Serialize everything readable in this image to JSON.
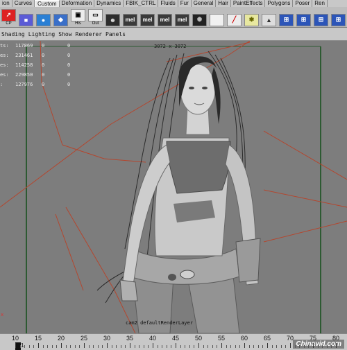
{
  "shelf_tabs": [
    "ion",
    "Curves",
    "Custom",
    "Deformation",
    "Dynamics",
    "FBIK_CTRL",
    "Fluids",
    "Fur",
    "General",
    "Hair",
    "PaintEffects",
    "Polygons",
    "Poser",
    "Ren"
  ],
  "active_tab": "Custom",
  "shelf_icons": [
    {
      "name": "cp-icon",
      "label": "CP"
    },
    {
      "name": "cube-icon",
      "label": ""
    },
    {
      "name": "sphere-icon",
      "label": ""
    },
    {
      "name": "plane-icon",
      "label": ""
    },
    {
      "name": "his-icon",
      "label": "His"
    },
    {
      "name": "out-icon",
      "label": "Out"
    },
    {
      "name": "head-icon",
      "label": ""
    },
    {
      "name": "mel-icon-1",
      "label": "mel"
    },
    {
      "name": "mel-icon-2",
      "label": "mel"
    },
    {
      "name": "mel-icon-3",
      "label": "mel"
    },
    {
      "name": "mel-icon-4",
      "label": "mel"
    },
    {
      "name": "galaxy-icon",
      "label": ""
    },
    {
      "name": "blank-icon",
      "label": ""
    },
    {
      "name": "brush-icon",
      "label": ""
    },
    {
      "name": "bulb-icon",
      "label": ""
    },
    {
      "name": "pyramid-icon",
      "label": ""
    },
    {
      "name": "grid-icon-1",
      "label": ""
    },
    {
      "name": "grid-icon-2",
      "label": ""
    },
    {
      "name": "grid-icon-3",
      "label": ""
    },
    {
      "name": "grid-icon-4",
      "label": ""
    }
  ],
  "panel_menu": [
    "Shading",
    "Lighting",
    "Show",
    "Renderer",
    "Panels"
  ],
  "hud_stats": [
    {
      "label": "ts:",
      "value": "117869",
      "c2": "0",
      "c3": "0"
    },
    {
      "label": "es:",
      "value": "231461",
      "c2": "0",
      "c3": "0"
    },
    {
      "label": "es:",
      "value": "114258",
      "c2": "0",
      "c3": "0"
    },
    {
      "label": "es:",
      "value": "229850",
      "c2": "0",
      "c3": "0"
    },
    {
      "label": ":",
      "value": "127976",
      "c2": "0",
      "c3": "0"
    }
  ],
  "resolution_gate": "3072 x 3072",
  "camera_label": "cam2 defaultRenderLayer",
  "axis_label": "x",
  "timeline": {
    "labels": [
      "10",
      "15",
      "20",
      "25",
      "30",
      "35",
      "40",
      "45",
      "50",
      "55",
      "60",
      "65",
      "70",
      "75",
      "80"
    ],
    "current_frame": "1"
  },
  "watermark": "Chinavid.com",
  "colors": {
    "viewport_bg": "#7d7d7d",
    "curve": "#b4462e",
    "green_frame": "#2d5a32"
  }
}
